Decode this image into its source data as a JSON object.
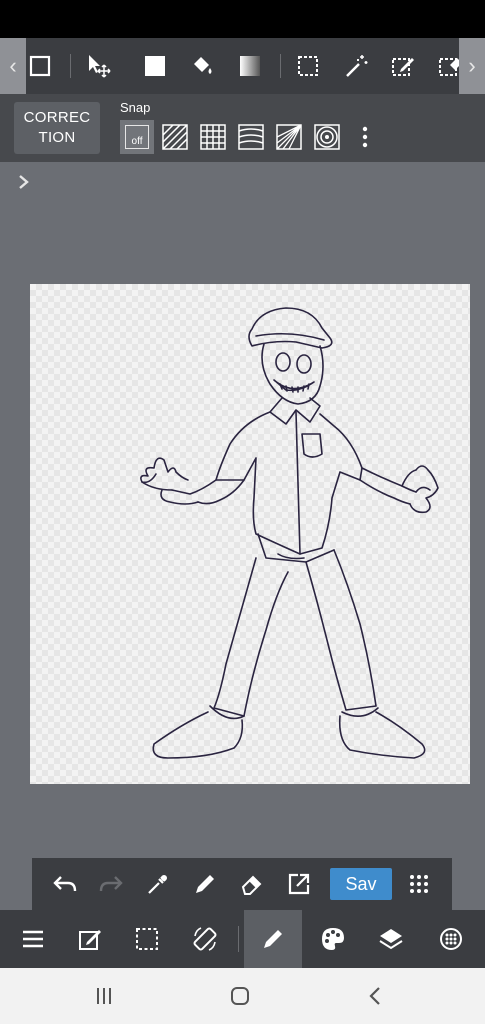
{
  "toolbar": {
    "scroll_left": "‹",
    "scroll_right": "›",
    "tools": [
      "rectangle-tool",
      "move-tool",
      "fill-tool",
      "bucket-tool",
      "gradient-tool",
      "select-tool",
      "magic-wand-tool",
      "select-pen-tool",
      "select-eraser-tool"
    ]
  },
  "snap_bar": {
    "correction_label": "CORREC\nTION",
    "snap_label": "Snap",
    "snap_off_label": "off",
    "options": [
      "snap-off",
      "parallel-snap",
      "grid-snap",
      "curve-snap",
      "perspective-snap",
      "concentric-snap"
    ]
  },
  "quick_bar": {
    "save_label": "Sav"
  },
  "colors": {
    "accent": "#3f8ccc",
    "toolbar_bg": "#3b3d41",
    "workspace_bg": "#6b6e74",
    "line_art": "#2a2440"
  }
}
